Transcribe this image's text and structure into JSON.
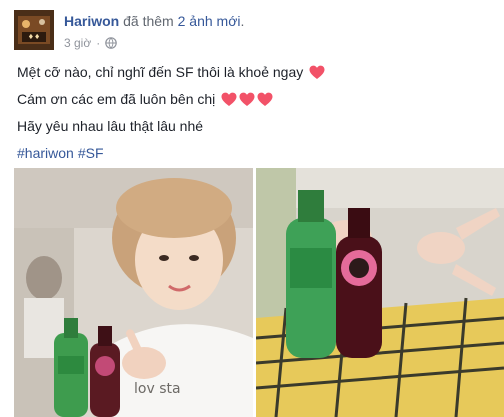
{
  "post": {
    "author": "Hariwon",
    "action": "đã thêm",
    "action_link": "2 ảnh mới",
    "action_end": ".",
    "time": "3 giờ",
    "separator": "·",
    "lines": [
      "Mệt cỡ nào, chỉ nghĩ đến SF thôi là khoẻ ngay",
      "Cám ơn các em đã luôn bên chị",
      "Hãy yêu nhau lâu thật lâu nhé"
    ],
    "hashtags": [
      "#hariwon",
      "#SF"
    ],
    "photos": [
      {
        "printed_text": "lov sta"
      },
      {
        "printed_text": ""
      }
    ]
  },
  "colors": {
    "link": "#365899",
    "heart": "#f25268",
    "meta": "#90949c"
  },
  "icons": [
    "globe-icon",
    "heart-icon"
  ]
}
